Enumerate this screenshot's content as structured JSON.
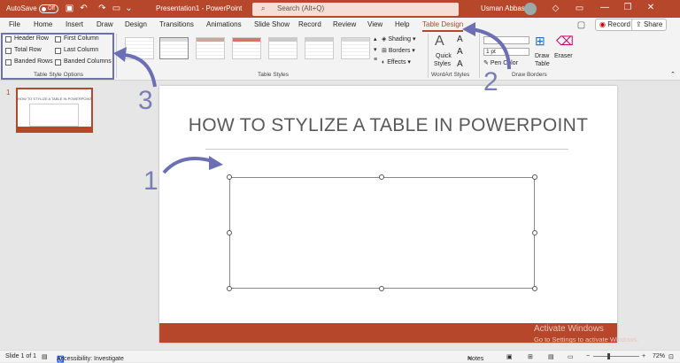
{
  "titlebar": {
    "autosave_label": "AutoSave",
    "autosave_state": "Off",
    "document_title": "Presentation1  -  PowerPoint",
    "search_placeholder": "Search (Alt+Q)",
    "user_name": "Usman Abbasi",
    "min_glyph": "—",
    "max_glyph": "❐",
    "close_glyph": "✕"
  },
  "tabs": [
    "File",
    "Home",
    "Insert",
    "Draw",
    "Design",
    "Transitions",
    "Animations",
    "Slide Show",
    "Record",
    "Review",
    "View",
    "Help",
    "Table Design"
  ],
  "active_tab": "Table Design",
  "record_button": "Record",
  "share_button": "Share",
  "ribbon": {
    "options": {
      "header_row": "Header Row",
      "total_row": "Total Row",
      "banded_rows": "Banded Rows",
      "first_column": "First Column",
      "last_column": "Last Column",
      "banded_columns": "Banded Columns",
      "group_label": "Table Style Options"
    },
    "table_styles_label": "Table Styles",
    "shading": "Shading",
    "borders": "Borders",
    "effects": "Effects",
    "quick_styles_1": "Quick",
    "quick_styles_2": "Styles",
    "wordart_label": "WordArt Styles",
    "pen_weight": "1 pt",
    "pen_color": "Pen Color",
    "draw_table_1": "Draw",
    "draw_table_2": "Table",
    "eraser": "Eraser",
    "draw_borders_label": "Draw Borders"
  },
  "sidebar": {
    "slide_number": "1",
    "thumb_title": "HOW TO STYLIZE A TABLE IN POWERPOINT"
  },
  "slide": {
    "title": "HOW TO STYLIZE A TABLE IN POWERPOINT"
  },
  "watermark": {
    "line1": "Activate Windows",
    "line2": "Go to Settings to activate Windows."
  },
  "statusbar": {
    "slide_info": "Slide 1 of 1",
    "accessibility": "Accessibility: Investigate",
    "notes": "Notes",
    "zoom": "72%"
  },
  "annotations": {
    "one": "1",
    "two": "2",
    "three": "3"
  },
  "colors": {
    "accent": "#b7472a",
    "annotation": "#6b6fb5"
  }
}
